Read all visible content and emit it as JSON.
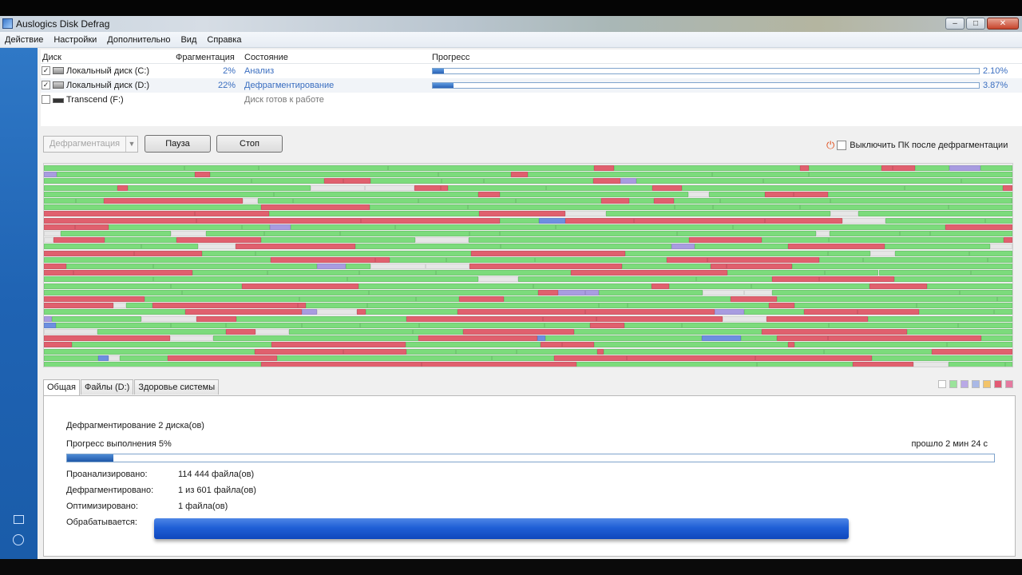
{
  "window": {
    "title": "Auslogics Disk Defrag"
  },
  "menu": [
    "Действие",
    "Настройки",
    "Дополнительно",
    "Вид",
    "Справка"
  ],
  "disk_list": {
    "headers": {
      "disk": "Диск",
      "frag": "Фрагментация",
      "state": "Состояние",
      "progress": "Прогресс"
    },
    "rows": [
      {
        "name": "Локальный диск (C:)",
        "checked": true,
        "frag": "2%",
        "state": "Анализ",
        "progress": 0.021,
        "progress_text": "2.10%"
      },
      {
        "name": "Локальный диск (D:)",
        "checked": true,
        "frag": "22%",
        "state": "Дефрагментирование",
        "progress": 0.0387,
        "progress_text": "3.87%"
      },
      {
        "name": "Transcend (F:)",
        "checked": false,
        "frag": "",
        "state": "Диск готов к работе",
        "progress": null,
        "progress_text": ""
      }
    ]
  },
  "controls": {
    "mode": "Дефрагментация",
    "pause": "Пауза",
    "stop": "Стоп",
    "shutdown_label": "Выключить ПК после дефрагментации"
  },
  "tabs": [
    "Общая",
    "Файлы (D:)",
    "Здоровье системы"
  ],
  "legend_colors": [
    "#ffffff",
    "#9be39b",
    "#b9a9e6",
    "#a9b8e6",
    "#f3c46a",
    "#e25a74",
    "#e57aa0"
  ],
  "general": {
    "title": "Дефрагментирование 2 диска(ов)",
    "progress_label": "Прогресс выполнения 5%",
    "progress": 0.05,
    "elapsed": "прошло 2 мин 24 с",
    "stats": [
      {
        "label": "Проанализировано:",
        "value": "114 444 файла(ов)"
      },
      {
        "label": "Дефрагментировано:",
        "value": "1 из 601 файла(ов)"
      },
      {
        "label": "Оптимизировано:",
        "value": "1 файла(ов)"
      },
      {
        "label": "Обрабатывается:",
        "value": ""
      }
    ]
  },
  "colors": {
    "green": "#7cdb7c",
    "red": "#e0606e",
    "gray": "#e6e6e6",
    "purple": "#a89ce0",
    "blue": "#6d8fe0",
    "orange": "#e8b548"
  }
}
